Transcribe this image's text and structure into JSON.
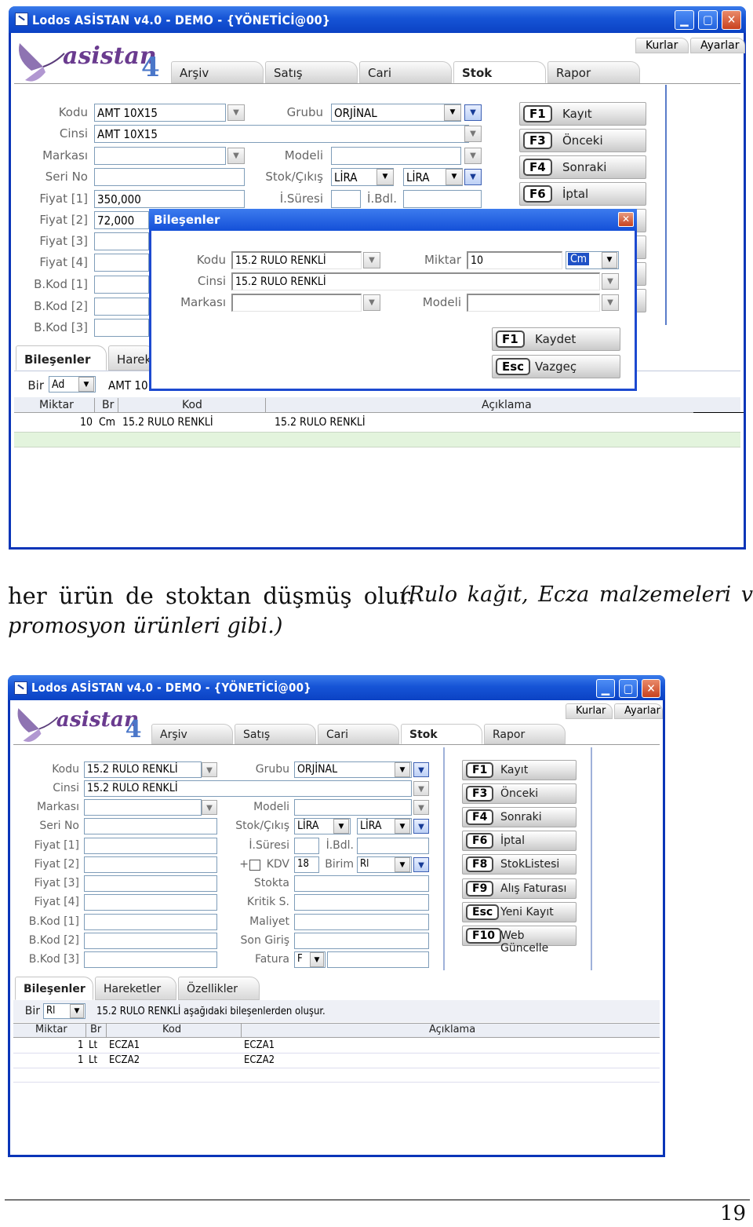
{
  "screen1": {
    "title": "Lodos ASİSTAN v4.0 - DEMO - {YÖNETİCİ@00}",
    "logo": "asistan",
    "logo_version": "4",
    "corner_tabs": [
      "Kurlar",
      "Ayarlar"
    ],
    "main_tabs": [
      "Arşiv",
      "Satış",
      "Cari",
      "Stok",
      "Rapor"
    ],
    "labels": {
      "kodu": "Kodu",
      "cinsi": "Cinsi",
      "markasi": "Markası",
      "seri_no": "Seri No",
      "fiyat1": "Fiyat [1]",
      "fiyat2": "Fiyat [2]",
      "fiyat3": "Fiyat [3]",
      "fiyat4": "Fiyat [4]",
      "bkod1": "B.Kod [1]",
      "bkod2": "B.Kod [2]",
      "bkod3": "B.Kod [3]",
      "grubu": "Grubu",
      "modeli": "Modeli",
      "stok_cikis": "Stok/Çıkış",
      "i_suresi": "İ.Süresi",
      "i_bdl": "İ.Bdl."
    },
    "values": {
      "kodu": "AMT 10X15",
      "cinsi": "AMT 10X15",
      "fiyat1": "350,000",
      "fiyat2": "72,000",
      "grubu": "ORJİNAL",
      "stok": "LİRA",
      "cikis": "LİRA"
    },
    "fbuttons": [
      {
        "key": "F1",
        "label": "Kayıt"
      },
      {
        "key": "F3",
        "label": "Önceki"
      },
      {
        "key": "F4",
        "label": "Sonraki"
      },
      {
        "key": "F6",
        "label": "İptal"
      }
    ],
    "bottom_tabs": [
      "Bileşenler",
      "Harek"
    ],
    "bir_label": "Bir",
    "bir_value": "Ad",
    "info_partial": "AMT 10",
    "grid_headers": [
      "Miktar",
      "Br",
      "Kod",
      "Açıklama"
    ],
    "grid_rows": [
      {
        "miktar": "10",
        "br": "Cm",
        "kod": "15.2 RULO RENKLİ",
        "aciklama": "15.2 RULO RENKLİ"
      }
    ],
    "dialog": {
      "title": "Bileşenler",
      "close": "✕",
      "labels": {
        "kodu": "Kodu",
        "cinsi": "Cinsi",
        "markasi": "Markası",
        "miktar": "Miktar",
        "modeli": "Modeli"
      },
      "values": {
        "kodu": "15.2 RULO RENKLİ",
        "cinsi": "15.2 RULO RENKLİ",
        "miktar": "10",
        "birim": "Cm"
      },
      "buttons": [
        {
          "key": "F1",
          "label": "Kaydet"
        },
        {
          "key": "Esc",
          "label": "Vazgeç"
        }
      ]
    }
  },
  "body_text": {
    "line1_plain": "her ürün de stoktan düşmüş olur.",
    "line1_italic": "(Rulo kağıt, Ecza malzemeleri veya",
    "line2_italic": "promosyon ürünleri gibi.)"
  },
  "screen2": {
    "title": "Lodos ASİSTAN v4.0 - DEMO - {YÖNETİCİ@00}",
    "logo": "asistan",
    "logo_version": "4",
    "corner_tabs": [
      "Kurlar",
      "Ayarlar"
    ],
    "main_tabs": [
      "Arşiv",
      "Satış",
      "Cari",
      "Stok",
      "Rapor"
    ],
    "labels": {
      "kodu": "Kodu",
      "cinsi": "Cinsi",
      "markasi": "Markası",
      "seri_no": "Seri No",
      "fiyat1": "Fiyat [1]",
      "fiyat2": "Fiyat [2]",
      "fiyat3": "Fiyat [3]",
      "fiyat4": "Fiyat [4]",
      "bkod1": "B.Kod [1]",
      "bkod2": "B.Kod [2]",
      "bkod3": "B.Kod [3]",
      "grubu": "Grubu",
      "modeli": "Modeli",
      "stok_cikis": "Stok/Çıkış",
      "i_suresi": "İ.Süresi",
      "i_bdl": "İ.Bdl.",
      "plus": "+",
      "kdv": "KDV",
      "birim": "Birim",
      "stokta": "Stokta",
      "kritik": "Kritik S.",
      "maliyet": "Maliyet",
      "son_giris": "Son Giriş",
      "fatura": "Fatura"
    },
    "values": {
      "kodu": "15.2 RULO RENKLİ",
      "cinsi": "15.2 RULO RENKLİ",
      "grubu": "ORJİNAL",
      "stok": "LİRA",
      "cikis": "LİRA",
      "kdv": "18",
      "birim": "Rl",
      "fatura": "F"
    },
    "fbuttons": [
      {
        "key": "F1",
        "label": "Kayıt"
      },
      {
        "key": "F3",
        "label": "Önceki"
      },
      {
        "key": "F4",
        "label": "Sonraki"
      },
      {
        "key": "F6",
        "label": "İptal"
      },
      {
        "key": "F8",
        "label": "StokListesi"
      },
      {
        "key": "F9",
        "label": "Alış Faturası"
      },
      {
        "key": "Esc",
        "label": "Yeni Kayıt"
      },
      {
        "key": "F10",
        "label": "Web Güncelle"
      }
    ],
    "bottom_tabs": [
      "Bileşenler",
      "Hareketler",
      "Özellikler"
    ],
    "bir_label": "Bir",
    "bir_value": "Rl",
    "info_text": "15.2 RULO RENKLİ aşağıdaki bileşenlerden oluşur.",
    "grid_headers": [
      "Miktar",
      "Br",
      "Kod",
      "Açıklama"
    ],
    "grid_rows": [
      {
        "miktar": "1",
        "br": "Lt",
        "kod": "ECZA1",
        "aciklama": "ECZA1"
      },
      {
        "miktar": "1",
        "br": "Lt",
        "kod": "ECZA2",
        "aciklama": "ECZA2"
      }
    ]
  },
  "page_number": "19",
  "icons": [
    "app-icon",
    "minimize-icon",
    "maximize-icon",
    "close-icon",
    "butterfly-logo-icon",
    "dropdown-arrow-icon",
    "checkbox-icon"
  ]
}
